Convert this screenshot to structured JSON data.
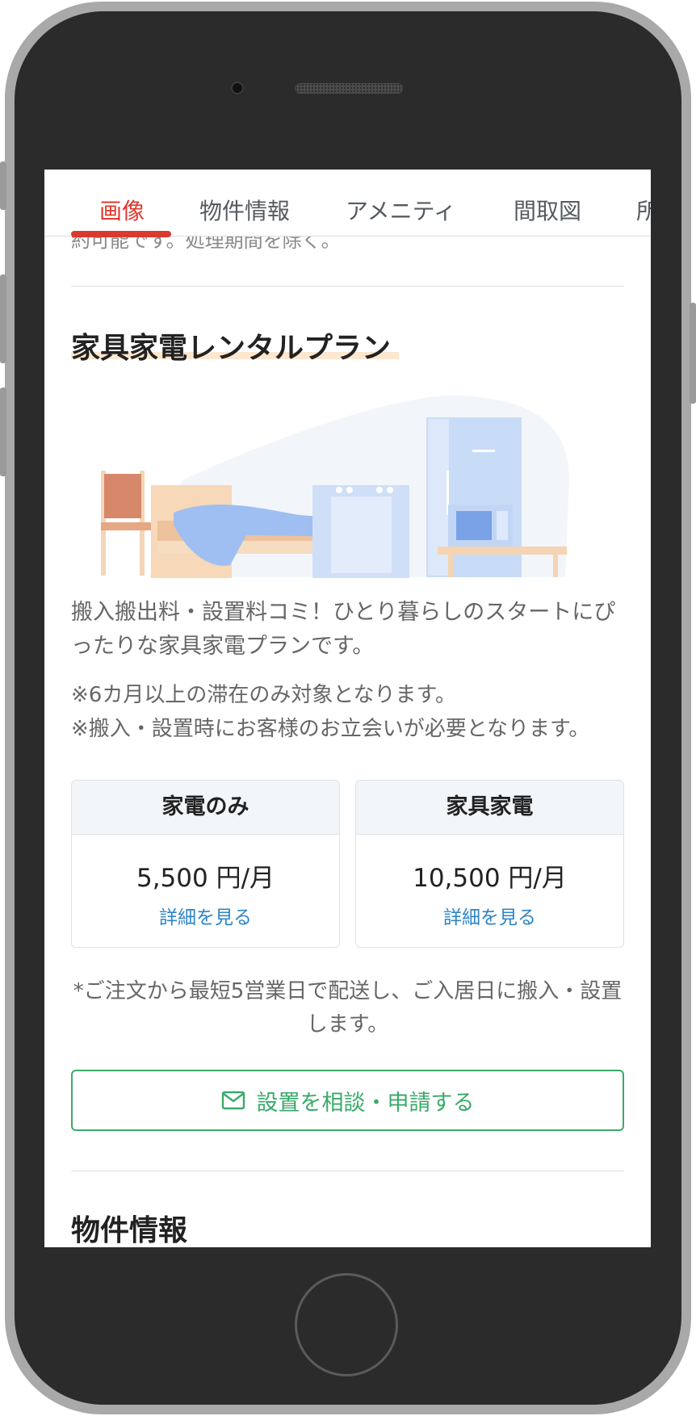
{
  "tabs": [
    {
      "label": "画像",
      "active": true
    },
    {
      "label": "物件情報",
      "active": false
    },
    {
      "label": "アメニティ",
      "active": false
    },
    {
      "label": "間取図",
      "active": false
    },
    {
      "label": "所",
      "active": false
    }
  ],
  "cut_text": "約可能です。処理期間を除く。",
  "rental": {
    "title": "家具家電レンタルプラン",
    "description": "搬入搬出料・設置料コミ！ひとり暮らしのスタートにぴったりな家具家電プランです。",
    "notes": [
      "※6カ月以上の滞在のみ対象となります。",
      "※搬入・設置時にお客様のお立会いが必要となります。"
    ],
    "plans": [
      {
        "name": "家電のみ",
        "price": "5,500 円/月",
        "link": "詳細を見る"
      },
      {
        "name": "家具家電",
        "price": "10,500 円/月",
        "link": "詳細を見る"
      }
    ],
    "delivery_note": "*ご注文から最短5営業日で配送し、ご入居日に搬入・設置します。",
    "consult_button": "設置を相談・申請する"
  },
  "next_section_title": "物件情報",
  "colors": {
    "accent_red": "#e0382c",
    "link_blue": "#2d84c7",
    "button_green": "#3aaa6a"
  },
  "icons": [
    "mail-icon",
    "furniture-illustration"
  ]
}
